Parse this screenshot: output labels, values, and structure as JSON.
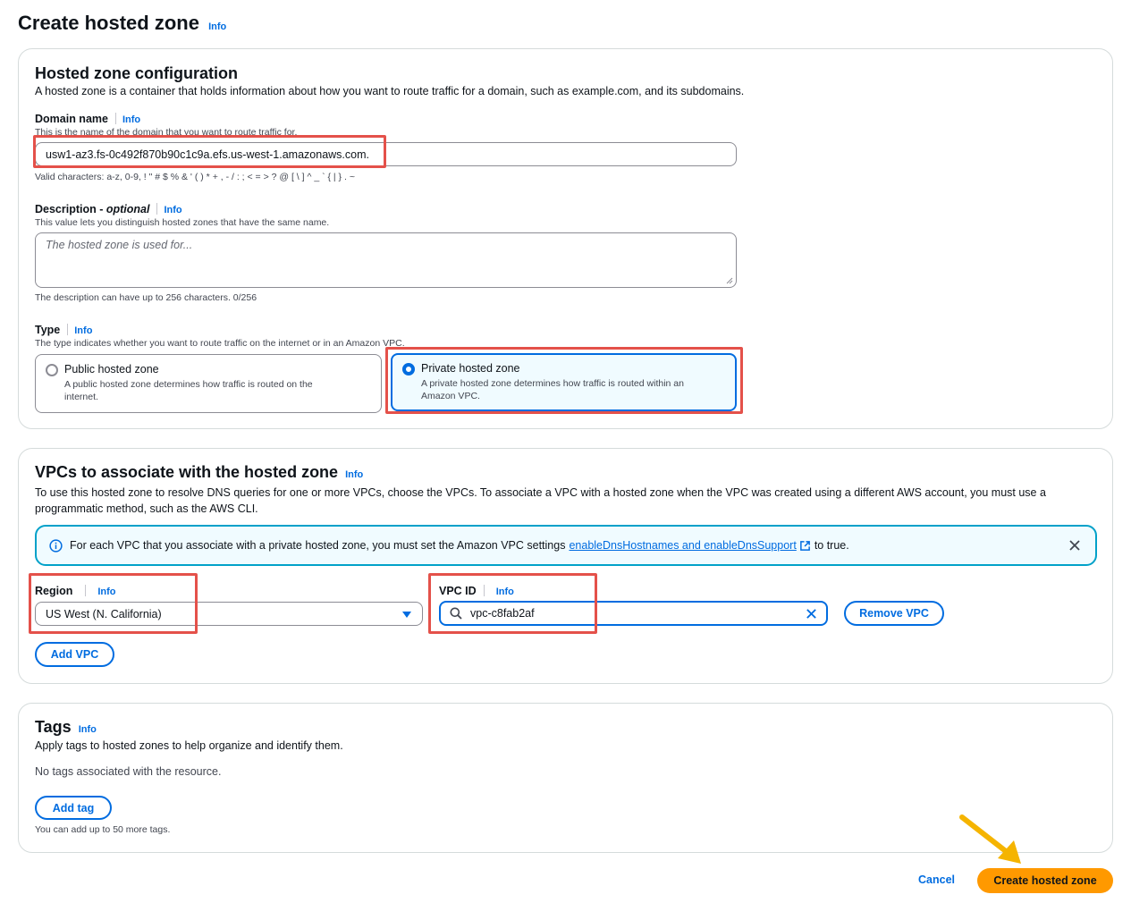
{
  "page": {
    "title": "Create hosted zone",
    "title_info": "Info"
  },
  "config": {
    "title": "Hosted zone configuration",
    "description": "A hosted zone is a container that holds information about how you want to route traffic for a domain, such as example.com, and its subdomains.",
    "domain": {
      "label": "Domain name",
      "info": "Info",
      "hint": "This is the name of the domain that you want to route traffic for.",
      "value": "usw1-az3.fs-0c492f870b90c1c9a.efs.us-west-1.amazonaws.com.",
      "constraint": "Valid characters: a-z, 0-9, ! \" # $ % & ' ( ) * + , - / : ; < = > ? @ [ \\ ] ^ _ ` { | } . ~"
    },
    "description_field": {
      "label": "Description",
      "optional": "optional",
      "info": "Info",
      "hint": "This value lets you distinguish hosted zones that have the same name.",
      "placeholder": "The hosted zone is used for...",
      "constraint": "The description can have up to 256 characters. 0/256"
    },
    "type": {
      "label": "Type",
      "info": "Info",
      "hint": "The type indicates whether you want to route traffic on the internet or in an Amazon VPC.",
      "public_title": "Public hosted zone",
      "public_desc_1": "A public hosted zone determines how traffic is routed on the",
      "public_desc_2": "internet.",
      "private_title": "Private hosted zone",
      "private_desc_1": "A private hosted zone determines how traffic is routed within an",
      "private_desc_2": "Amazon VPC.",
      "selected": "private"
    }
  },
  "vpcs": {
    "title": "VPCs to associate with the hosted zone",
    "info": "Info",
    "description_1": "To use this hosted zone to resolve DNS queries for one or more VPCs, choose the VPCs. To associate a VPC with a hosted zone when the VPC was created using a different AWS account, you must use a",
    "description_2": "programmatic method, such as the AWS CLI.",
    "alert_text": "For each VPC that you associate with a private hosted zone, you must set the Amazon VPC settings",
    "alert_link": "enableDnsHostnames and enableDnsSupport",
    "alert_suffix": "to true.",
    "region_label": "Region",
    "region_info": "Info",
    "region_value": "US West (N. California)",
    "vpc_label": "VPC ID",
    "vpc_info": "Info",
    "vpc_value": "vpc-c8fab2af",
    "remove_button": "Remove VPC",
    "add_button": "Add VPC"
  },
  "tags": {
    "title": "Tags",
    "info": "Info",
    "description": "Apply tags to hosted zones to help organize and identify them.",
    "empty": "No tags associated with the resource.",
    "add_button": "Add tag",
    "limit": "You can add up to 50 more tags."
  },
  "footer": {
    "cancel": "Cancel",
    "submit": "Create hosted zone"
  },
  "colors": {
    "accent": "#006ce0",
    "primary_button": "#ff9900",
    "highlight": "#e4514a",
    "arrow": "#f5b400"
  }
}
